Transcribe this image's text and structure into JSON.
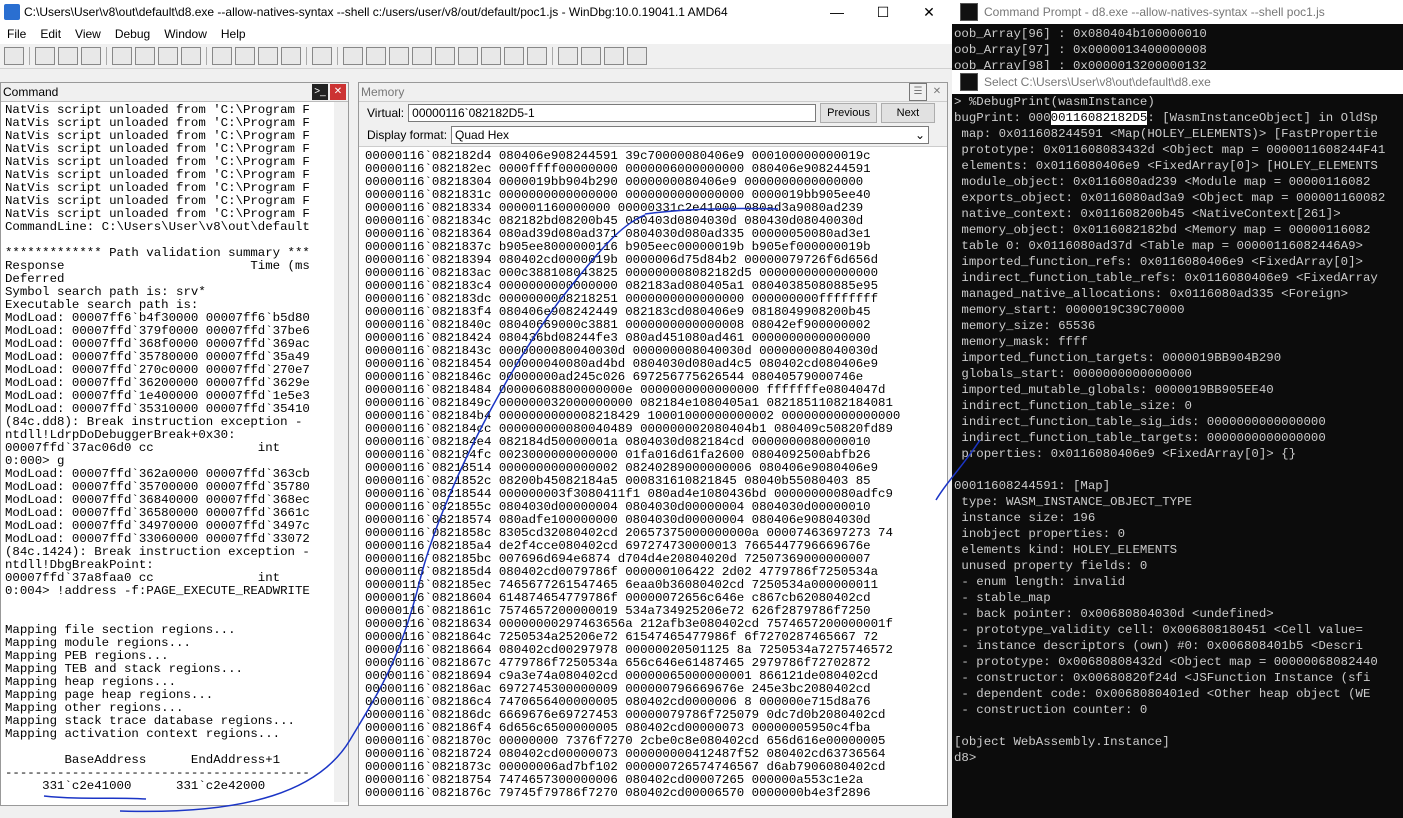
{
  "windbg": {
    "title": "C:\\Users\\User\\v8\\out\\default\\d8.exe --allow-natives-syntax --shell c:/users/user/v8/out/default/poc1.js - WinDbg:10.0.19041.1 AMD64",
    "menu": [
      "File",
      "Edit",
      "View",
      "Debug",
      "Window",
      "Help"
    ],
    "minimize": "—",
    "maximize": "☐",
    "close": "✕"
  },
  "command": {
    "title": "Command",
    "lines": [
      "NatVis script unloaded from 'C:\\Program F",
      "NatVis script unloaded from 'C:\\Program F",
      "NatVis script unloaded from 'C:\\Program F",
      "NatVis script unloaded from 'C:\\Program F",
      "NatVis script unloaded from 'C:\\Program F",
      "NatVis script unloaded from 'C:\\Program F",
      "NatVis script unloaded from 'C:\\Program F",
      "NatVis script unloaded from 'C:\\Program F",
      "NatVis script unloaded from 'C:\\Program F",
      "CommandLine: C:\\Users\\User\\v8\\out\\default",
      "",
      "************* Path validation summary ***",
      "Response                         Time (ms",
      "Deferred",
      "Symbol search path is: srv*",
      "Executable search path is:",
      "ModLoad: 00007ff6`b4f30000 00007ff6`b5d80",
      "ModLoad: 00007ffd`379f0000 00007ffd`37be6",
      "ModLoad: 00007ffd`368f0000 00007ffd`369ac",
      "ModLoad: 00007ffd`35780000 00007ffd`35a49",
      "ModLoad: 00007ffd`270c0000 00007ffd`270e7",
      "ModLoad: 00007ffd`36200000 00007ffd`3629e",
      "ModLoad: 00007ffd`1e400000 00007ffd`1e5e3",
      "ModLoad: 00007ffd`35310000 00007ffd`35410",
      "(84c.dd8): Break instruction exception -",
      "ntdll!LdrpDoDebuggerBreak+0x30:",
      "00007ffd`37ac06d0 cc              int",
      "0:000> g",
      "ModLoad: 00007ffd`362a0000 00007ffd`363cb",
      "ModLoad: 00007ffd`35700000 00007ffd`35780",
      "ModLoad: 00007ffd`36840000 00007ffd`368ec",
      "ModLoad: 00007ffd`36580000 00007ffd`3661c",
      "ModLoad: 00007ffd`34970000 00007ffd`3497c",
      "ModLoad: 00007ffd`33060000 00007ffd`33072",
      "(84c.1424): Break instruction exception -",
      "ntdll!DbgBreakPoint:",
      "00007ffd`37a8faa0 cc              int",
      "0:004> !address -f:PAGE_EXECUTE_READWRITE",
      "",
      "",
      "Mapping file section regions...",
      "Mapping module regions...",
      "Mapping PEB regions...",
      "Mapping TEB and stack regions...",
      "Mapping heap regions...",
      "Mapping page heap regions...",
      "Mapping other regions...",
      "Mapping stack trace database regions...",
      "Mapping activation context regions...",
      "",
      "        BaseAddress      EndAddress+1",
      "-----------------------------------------",
      "     331`c2e41000      331`c2e42000"
    ]
  },
  "memory": {
    "title": "Memory",
    "virtual_label": "Virtual:",
    "virtual_value": "00000116`082182D5-1",
    "previous": "Previous",
    "next": "Next",
    "format_label": "Display format:",
    "format_value": "Quad Hex",
    "lines": [
      "00000116`082182d4 080406e908244591 39c70000080406e9 000100000000019c",
      "00000116`082182ec 0000ffff00000000 0000006000000000 080406e908244591",
      "00000116`08218304 0000019bb904b290 0000000080406e9 0000000000000000",
      "00000116`0821831c 0000000000000000 0000000000000000 0000019bb905ee40",
      "00000116`08218334 000001160000000 00000331c2e41000 080ad3a9080ad239",
      "00000116`0821834c 082182bd08200b45 080403d0804030d 080430d08040030d",
      "00000116`08218364 080ad39d080ad371 0804030d080ad335 00000050080ad3e1",
      "00000116`0821837c b905ee8000000116 b905eec00000019b b905ef000000019b",
      "00000116`08218394 080402cd0000019b 0000006d75d84b2 00000079726f6d656d",
      "00000116`082183ac 000c388108043825 000000008082182d5 0000000000000000",
      "00000116`082183c4 0000000000000000 082183ad080405a1 08040385080885e95",
      "00000116`082183dc 0000000008218251 0000000000000000 000000000ffffffff",
      "00000116`082183f4 080406e908242449 082183cd080406e9 0818049908200b45",
      "00000116`0821840c 08040669000c3881 0000000000000008 08042ef900000002",
      "00000116`08218424 080436bd08244fe3 080ad451080ad461 0000000000000000",
      "00000116`0821843c 0000000080040030d 000000008040030d 000000008040030d",
      "00000116`08218454 000000040080ad4bd 0804030d080ad4c5 080402cd080406e9",
      "00000116`0821846c 00000000ad245c026 697256775626544 08040579000746e",
      "00000116`08218484 00000608800000000e 0000000000000000 fffffffe0804047d",
      "00000116`0821849c 000000032000000000 082184e1080405a1 08218511082184081",
      "00000116`082184b4 0000000000008218429 10001000000000002 0000000000000000",
      "00000116`082184cc 000000000080040489 000000002080404b1 080409c50820fd89",
      "00000116`082184e4 082184d50000001a 0804030d082184cd 0000000080000010",
      "00000116`082184fc 0023000000000000 01fa016d61fa2600 0804092500abfb26",
      "00000116`08218514 0000000000000002 08240289000000006 080406e9080406e9",
      "00000116`0821852c 08200b45082184a5 000831610821845 08040b55080403 85",
      "00000116`08218544 000000003f3080411f1 080ad4e1080436bd 00000000080adfc9",
      "00000116`0821855c 0804030d00000004 0804030d00000004 0804030d00000010",
      "00000116`08218574 080adfe100000000 0804030d00000004 080406e90804030d",
      "00000116`0821858c 8305cd32080402cd 20657375000000000a 00007463697273 74",
      "00000116`082185a4 de2f4cce080402cd 697274730000013 7665447796669676e",
      "00000116`082185bc 007696d694e6874 d704d4e20804020d 72507369000000007",
      "00000116`082185d4 080402cd0079786f 000000106422 2d02 4779786f7250534a",
      "00000116`082185ec 7465677261547465 6eaa0b36080402cd 7250534a000000011",
      "00000116`08218604 614874654779786f 00000072656c646e c867cb62080402cd",
      "00000116`0821861c 7574657200000019 534a734925206e72 626f2879786f7250",
      "00000116`08218634 00000000297463656a 212afb3e080402cd 7574657200000001f",
      "00000116`0821864c 7250534a25206e72 61547465477986f 6f7270287465667 72",
      "00000116`08218664 080402cd00297978 00000020501125 8a 7250534a7275746572",
      "00000116`0821867c 4779786f7250534a 656c646e61487465 2979786f72702872",
      "00000116`08218694 c9a3e74a080402cd 00000065000000001 866121de080402cd",
      "00000116`082186ac 6972745300000009 000000796669676e 245e3bc2080402cd",
      "00000116`082186c4 7470656400000005 080402cd0000006 8 000000e715d8a76",
      "00000116`082186dc 6669676e69727453 00000079786f725079 0dc7d0b2080402cd",
      "00000116`082186f4 6d656c6500000005 080402cd00000073 00000005950c4fba",
      "00000116`0821870c 00000000 7376f7270 2cbe0c8e080402cd 656d616e00000005",
      "00000116`08218724 080402cd00000073 000000000412487f52 080402cd63736564",
      "00000116`0821873c 00000006ad7bf102 000000726574746567 d6ab7906080402cd",
      "00000116`08218754 7474657300000006 080402cd00007265 000000a553c1e2a",
      "00000116`0821876c 79745f79786f7270 080402cd00006570 0000000b4e3f2896"
    ]
  },
  "cmdprompt": {
    "title1": "Command Prompt - d8.exe --allow-natives-syntax --shell poc1.js",
    "title2": "Select C:\\Users\\User\\v8\\out\\default\\d8.exe",
    "top_lines": [
      "oob_Array[96] : 0x080404b100000010",
      "oob_Array[97] : 0x0000013400000008",
      "oob_Array[98] : 0x0000013200000132"
    ],
    "debug_prefix": "bugPrint: 000",
    "debug_highlight": "00116082182D5",
    "debug_suffix": ": [WasmInstanceObject] in OldSp",
    "lines": [
      "> %DebugPrint(wasmInstance)",
      " map: 0x011608244591 <Map(HOLEY_ELEMENTS)> [FastPropertie",
      " prototype: 0x011608083432d <Object map = 0000011608244F41",
      " elements: 0x0116080406e9 <FixedArray[0]> [HOLEY_ELEMENTS",
      " module_object: 0x0116080ad239 <Module map = 00000116082",
      " exports_object: 0x0116080ad3a9 <Object map = 000001160082",
      " native_context: 0x011608200b45 <NativeContext[261]>",
      " memory_object: 0x0116082182bd <Memory map = 00000116082",
      " table 0: 0x0116080ad37d <Table map = 00000116082446A9>",
      " imported_function_refs: 0x0116080406e9 <FixedArray[0]>",
      " indirect_function_table_refs: 0x0116080406e9 <FixedArray",
      " managed_native_allocations: 0x0116080ad335 <Foreign>",
      " memory_start: 0000019C39C70000",
      " memory_size: 65536",
      " memory_mask: ffff",
      " imported_function_targets: 0000019BB904B290",
      " globals_start: 0000000000000000",
      " imported_mutable_globals: 0000019BB905EE40",
      " indirect_function_table_size: 0",
      " indirect_function_table_sig_ids: 0000000000000000",
      " indirect_function_table_targets: 0000000000000000",
      " properties: 0x0116080406e9 <FixedArray[0]> {}",
      "",
      "00011608244591: [Map]",
      " type: WASM_INSTANCE_OBJECT_TYPE",
      " instance size: 196",
      " inobject properties: 0",
      " elements kind: HOLEY_ELEMENTS",
      " unused property fields: 0",
      " - enum length: invalid",
      " - stable_map",
      " - back pointer: 0x00680804030d <undefined>",
      " - prototype_validity cell: 0x006808180451 <Cell value=",
      " - instance descriptors (own) #0: 0x006808401b5 <Descri",
      " - prototype: 0x00680808432d <Object map = 00000068082440",
      " - constructor: 0x00680820f24d <JSFunction Instance (sfi",
      " - dependent code: 0x0068080401ed <Other heap object (WE",
      " - construction counter: 0",
      "",
      "[object WebAssembly.Instance]",
      "d8>"
    ]
  }
}
